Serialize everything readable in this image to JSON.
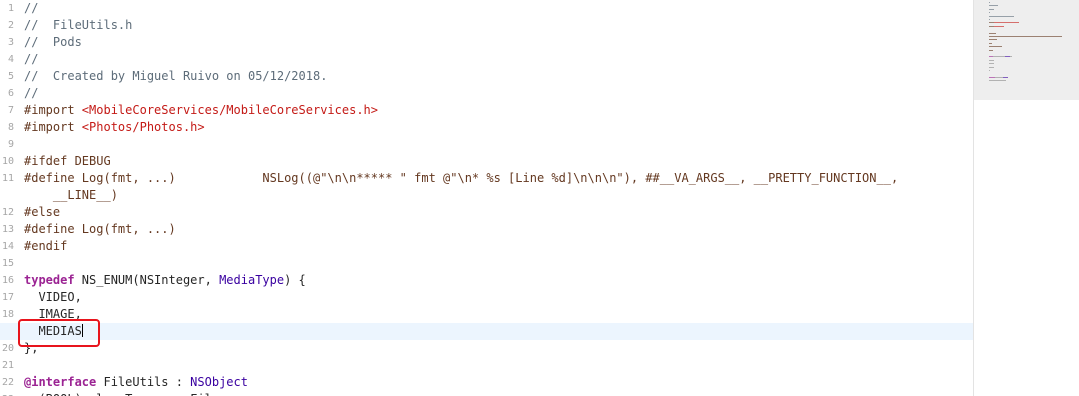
{
  "editor": {
    "file_name": "FileUtils.h",
    "current_line": 19,
    "lines": [
      {
        "num": "1",
        "segments": [
          {
            "c": "c",
            "t": "//"
          }
        ]
      },
      {
        "num": "2",
        "segments": [
          {
            "c": "c",
            "t": "//  FileUtils.h"
          }
        ]
      },
      {
        "num": "3",
        "segments": [
          {
            "c": "c",
            "t": "//  Pods"
          }
        ]
      },
      {
        "num": "4",
        "segments": [
          {
            "c": "c",
            "t": "//"
          }
        ]
      },
      {
        "num": "5",
        "segments": [
          {
            "c": "c",
            "t": "//  Created by Miguel Ruivo on 05/12/2018."
          }
        ]
      },
      {
        "num": "6",
        "segments": [
          {
            "c": "c",
            "t": "//"
          }
        ]
      },
      {
        "num": "7",
        "segments": [
          {
            "c": "p",
            "t": "#import "
          },
          {
            "c": "s",
            "t": "<MobileCoreServices/MobileCoreServices.h>"
          }
        ]
      },
      {
        "num": "8",
        "segments": [
          {
            "c": "p",
            "t": "#import "
          },
          {
            "c": "s",
            "t": "<Photos/Photos.h>"
          }
        ]
      },
      {
        "num": "9",
        "segments": []
      },
      {
        "num": "10",
        "segments": [
          {
            "c": "p",
            "t": "#ifdef DEBUG"
          }
        ]
      },
      {
        "num": "11",
        "segments": [
          {
            "c": "p",
            "t": "#define Log(fmt, ...)            NSLog((@\"\\n\\n***** \" fmt @\"\\n* %s [Line %d]\\n\\n\\n\"), ##__VA_ARGS__, __PRETTY_FUNCTION__,"
          }
        ]
      },
      {
        "num": "",
        "segments": [
          {
            "c": "p",
            "t": "    __LINE__)"
          }
        ]
      },
      {
        "num": "12",
        "segments": [
          {
            "c": "p",
            "t": "#else"
          }
        ]
      },
      {
        "num": "13",
        "segments": [
          {
            "c": "p",
            "t": "#define Log(fmt, ...)"
          }
        ]
      },
      {
        "num": "14",
        "segments": [
          {
            "c": "p",
            "t": "#endif"
          }
        ]
      },
      {
        "num": "15",
        "segments": []
      },
      {
        "num": "16",
        "segments": [
          {
            "c": "k",
            "t": "typedef"
          },
          {
            "c": "pl",
            "t": " NS_ENUM(NSInteger, "
          },
          {
            "c": "t",
            "t": "MediaType"
          },
          {
            "c": "pl",
            "t": ") {"
          }
        ]
      },
      {
        "num": "17",
        "segments": [
          {
            "c": "pl",
            "t": "  VIDEO,"
          }
        ]
      },
      {
        "num": "18",
        "segments": [
          {
            "c": "pl",
            "t": "  IMAGE,"
          }
        ]
      },
      {
        "num": "19",
        "segments": [
          {
            "c": "pl",
            "t": "  MEDIAS"
          }
        ],
        "current": true
      },
      {
        "num": "20",
        "segments": [
          {
            "c": "pl",
            "t": "};"
          }
        ]
      },
      {
        "num": "21",
        "segments": []
      },
      {
        "num": "22",
        "segments": [
          {
            "c": "k",
            "t": "@interface"
          },
          {
            "c": "pl",
            "t": " FileUtils : "
          },
          {
            "c": "t",
            "t": "NSObject"
          }
        ]
      },
      {
        "num": "23",
        "segments": [
          {
            "c": "pl",
            "t": "  (BOOL) clearTemporaryFiles;"
          }
        ]
      }
    ]
  },
  "colors": {
    "comment": "#5d6c79",
    "preprocessor": "#643820",
    "string": "#c41a16",
    "keyword": "#9b2393",
    "type": "#3900a0",
    "highlight_box": "#e8141c",
    "current_line_bg": "#ecf5fe"
  }
}
